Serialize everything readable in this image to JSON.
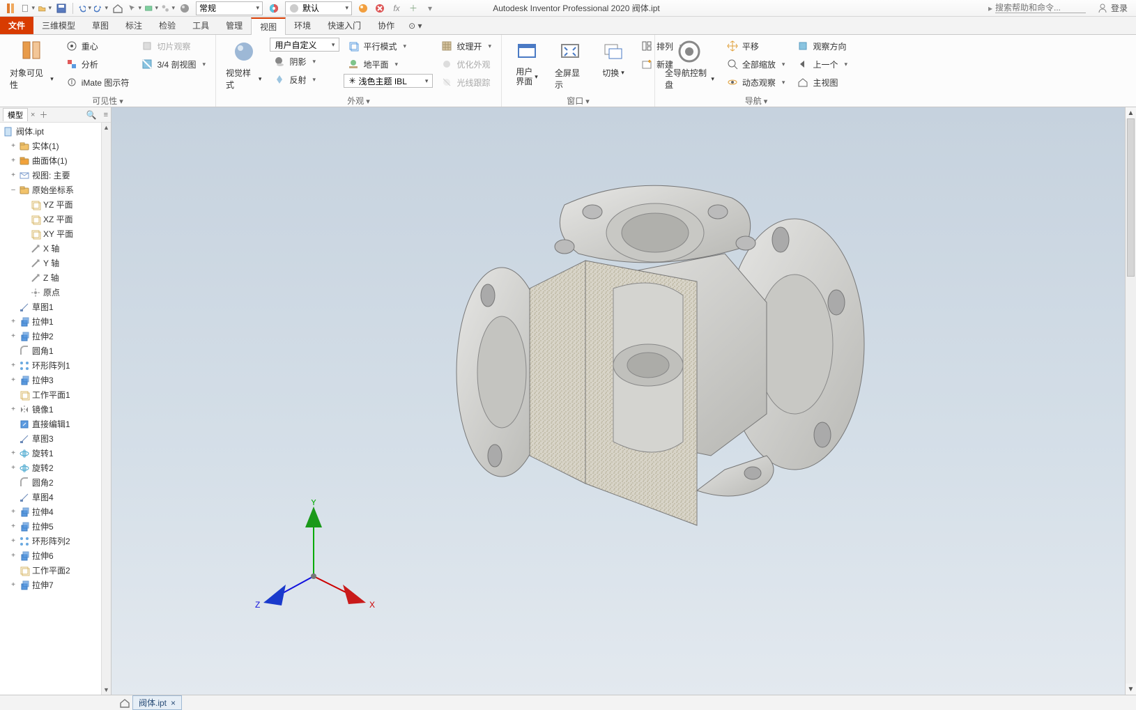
{
  "app": {
    "title": "Autodesk Inventor Professional 2020   阀体.ipt",
    "search_placeholder": "搜索帮助和命令...",
    "login": "登录"
  },
  "qat": {
    "combo1": "常规",
    "combo2": "默认",
    "fx": "fx"
  },
  "tabs": {
    "file": "文件",
    "t1": "三维模型",
    "t2": "草图",
    "t3": "标注",
    "t4": "检验",
    "t5": "工具",
    "t6": "管理",
    "t7": "视图",
    "t8": "环境",
    "t9": "快速入门",
    "t10": "协作"
  },
  "ribbon": {
    "p1": {
      "label": "可见性",
      "big": "对象可见性",
      "i1": "重心",
      "i2": "分析",
      "i3": "iMate 图示符",
      "i4": "切片观察",
      "i5": "3/4 剖视图"
    },
    "p2": {
      "label": "外观",
      "big": "视觉样式",
      "combo1": "用户自定义",
      "i1": "阴影",
      "i2": "反射",
      "i3": "平行模式",
      "i4": "地平面",
      "combo2": "浅色主题 IBL",
      "i5": "纹理开",
      "i6": "优化外观",
      "i7": "光线跟踪"
    },
    "p3": {
      "label": "窗口",
      "b1": "用户\n界面",
      "b2": "全屏显示",
      "b3": "切换",
      "i1": "排列",
      "i2": "新建"
    },
    "p4": {
      "label": "导航",
      "big": "全导航控制盘",
      "i1": "平移",
      "i2": "全部缩放",
      "i3": "动态观察",
      "i4": "观察方向",
      "i5": "上一个",
      "i6": "主视图"
    }
  },
  "browser": {
    "tab": "模型",
    "root": "阀体.ipt",
    "items": [
      {
        "d": 1,
        "exp": "+",
        "icon": "folder",
        "fill": "#f2c36b",
        "label": "实体(1)"
      },
      {
        "d": 1,
        "exp": "+",
        "icon": "folder",
        "fill": "#f2a23a",
        "label": "曲面体(1)"
      },
      {
        "d": 1,
        "exp": "+",
        "icon": "view",
        "fill": "#7a9acc",
        "label": "视图: 主要"
      },
      {
        "d": 1,
        "exp": "–",
        "icon": "folder",
        "fill": "#f2c36b",
        "label": "原始坐标系"
      },
      {
        "d": 2,
        "exp": "",
        "icon": "plane",
        "fill": "#d9b96b",
        "label": "YZ 平面"
      },
      {
        "d": 2,
        "exp": "",
        "icon": "plane",
        "fill": "#d9b96b",
        "label": "XZ 平面"
      },
      {
        "d": 2,
        "exp": "",
        "icon": "plane",
        "fill": "#d9b96b",
        "label": "XY 平面"
      },
      {
        "d": 2,
        "exp": "",
        "icon": "axis",
        "fill": "#999",
        "label": "X 轴"
      },
      {
        "d": 2,
        "exp": "",
        "icon": "axis",
        "fill": "#999",
        "label": "Y 轴"
      },
      {
        "d": 2,
        "exp": "",
        "icon": "axis",
        "fill": "#999",
        "label": "Z 轴"
      },
      {
        "d": 2,
        "exp": "",
        "icon": "point",
        "fill": "#999",
        "label": "原点"
      },
      {
        "d": 1,
        "exp": "",
        "icon": "sketch",
        "fill": "#6a89b8",
        "label": "草图1"
      },
      {
        "d": 1,
        "exp": "+",
        "icon": "extrude",
        "fill": "#5c9be0",
        "label": "拉伸1"
      },
      {
        "d": 1,
        "exp": "+",
        "icon": "extrude",
        "fill": "#5c9be0",
        "label": "拉伸2"
      },
      {
        "d": 1,
        "exp": "",
        "icon": "fillet",
        "fill": "#aaa",
        "label": "圆角1"
      },
      {
        "d": 1,
        "exp": "+",
        "icon": "pattern",
        "fill": "#6aa9e0",
        "label": "环形阵列1"
      },
      {
        "d": 1,
        "exp": "+",
        "icon": "extrude",
        "fill": "#5c9be0",
        "label": "拉伸3"
      },
      {
        "d": 1,
        "exp": "",
        "icon": "plane",
        "fill": "#d9b96b",
        "label": "工作平面1"
      },
      {
        "d": 1,
        "exp": "+",
        "icon": "mirror",
        "fill": "#888",
        "label": "镜像1"
      },
      {
        "d": 1,
        "exp": "",
        "icon": "direct",
        "fill": "#5c9be0",
        "label": "直接编辑1"
      },
      {
        "d": 1,
        "exp": "",
        "icon": "sketch",
        "fill": "#6a89b8",
        "label": "草图3"
      },
      {
        "d": 1,
        "exp": "+",
        "icon": "revolve",
        "fill": "#4aa8cf",
        "label": "旋转1"
      },
      {
        "d": 1,
        "exp": "+",
        "icon": "revolve",
        "fill": "#4aa8cf",
        "label": "旋转2"
      },
      {
        "d": 1,
        "exp": "",
        "icon": "fillet",
        "fill": "#aaa",
        "label": "圆角2"
      },
      {
        "d": 1,
        "exp": "",
        "icon": "sketch",
        "fill": "#6a89b8",
        "label": "草图4"
      },
      {
        "d": 1,
        "exp": "+",
        "icon": "extrude",
        "fill": "#5c9be0",
        "label": "拉伸4"
      },
      {
        "d": 1,
        "exp": "+",
        "icon": "extrude",
        "fill": "#5c9be0",
        "label": "拉伸5"
      },
      {
        "d": 1,
        "exp": "+",
        "icon": "pattern",
        "fill": "#6aa9e0",
        "label": "环形阵列2"
      },
      {
        "d": 1,
        "exp": "+",
        "icon": "extrude",
        "fill": "#5c9be0",
        "label": "拉伸6"
      },
      {
        "d": 1,
        "exp": "",
        "icon": "plane",
        "fill": "#d9b96b",
        "label": "工作平面2"
      },
      {
        "d": 1,
        "exp": "+",
        "icon": "extrude",
        "fill": "#5c9be0",
        "label": "拉伸7"
      }
    ]
  },
  "triad": {
    "x": "X",
    "y": "Y",
    "z": "Z"
  },
  "status": {
    "doc": "阀体.ipt"
  }
}
